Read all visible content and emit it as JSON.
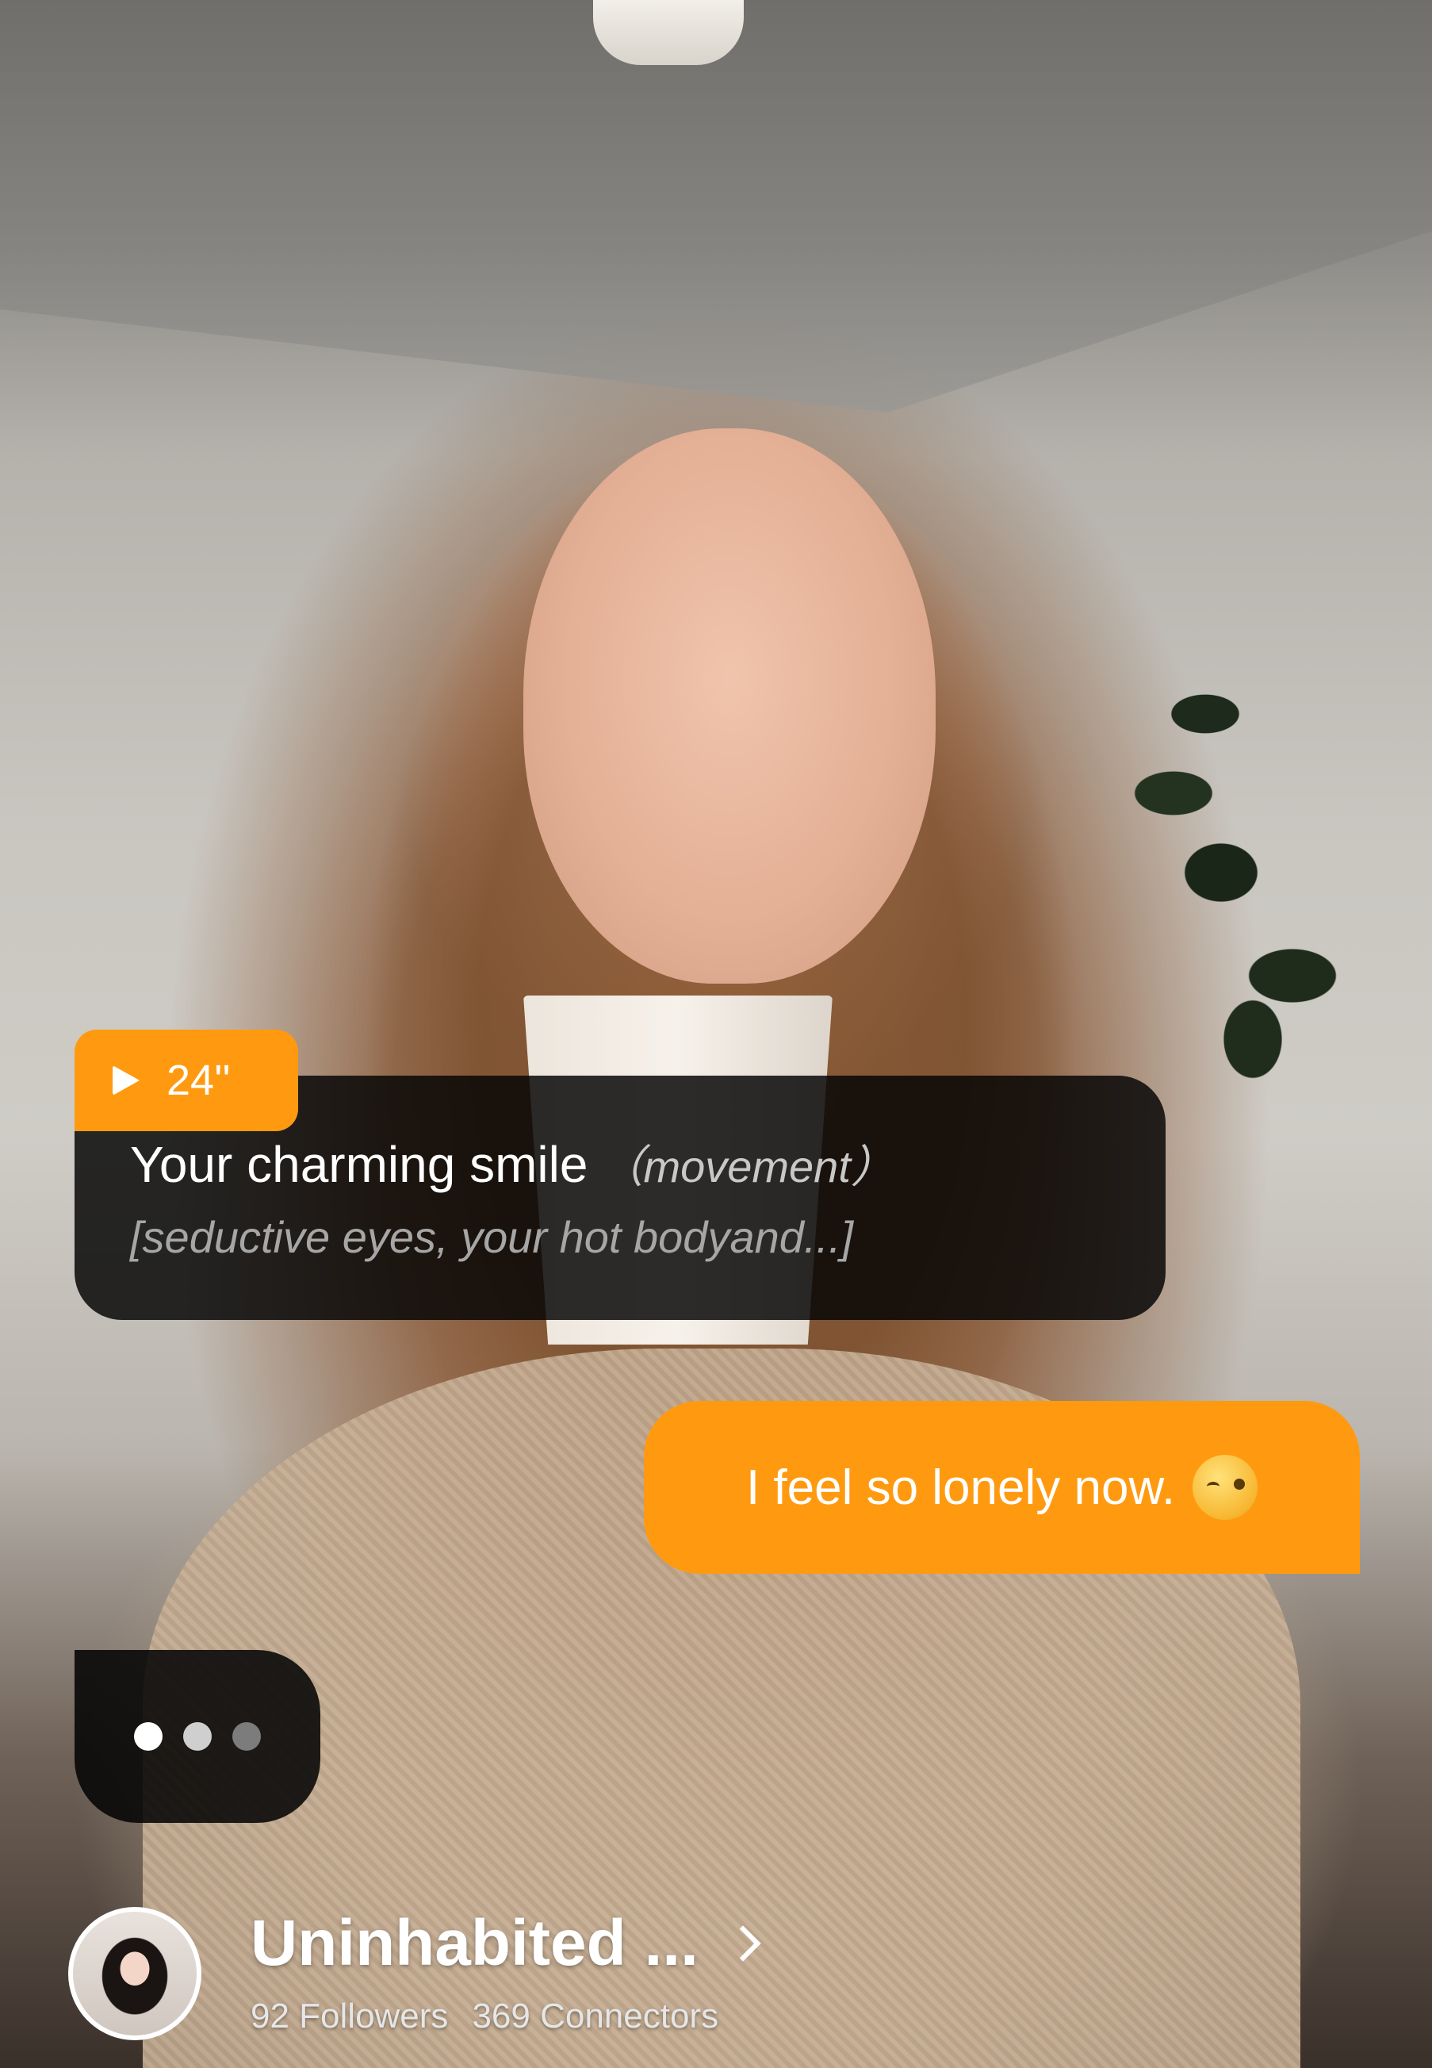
{
  "ai_message": {
    "duration": "24''",
    "text": "Your charming smile",
    "action": "（movement）",
    "detail": "[seductive eyes, your hot bodyand...]"
  },
  "user_message": {
    "text": "I feel so lonely now.",
    "emoji_icon": "face-blowing-kiss-icon"
  },
  "typing_indicator": {
    "dots": 3
  },
  "profile": {
    "name": "Uninhabited ...",
    "followers": "92 Followers",
    "connectors": "369 Connectors"
  },
  "colors": {
    "accent": "#ff9a10",
    "bubble_dark": "#050505"
  }
}
